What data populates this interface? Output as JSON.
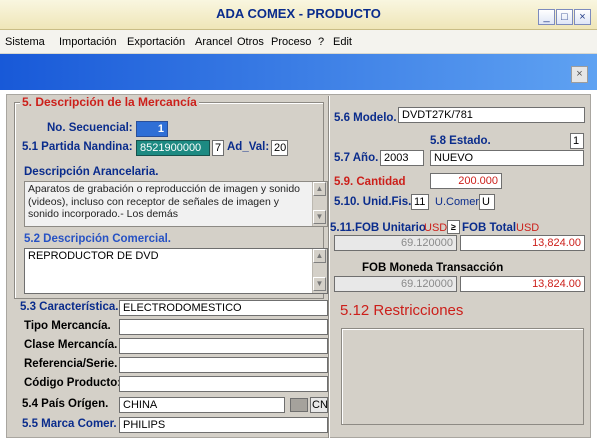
{
  "window": {
    "title": "ADA COMEX - PRODUCTO",
    "minimize_label": "_",
    "maximize_label": "□",
    "close_label": "×"
  },
  "menu": [
    "Sistema",
    "Importación",
    "Exportación",
    "Arancel",
    "Otros",
    "Proceso",
    "?",
    "Edit"
  ],
  "toolbar": {
    "close_label": "×"
  },
  "section5": {
    "title": "5. Descripción de la Mercancía",
    "no_secuencial_label": "No. Secuencial:",
    "no_secuencial_value": "1",
    "partida_label": "5.1 Partida Nandina:",
    "partida_value": "8521900000",
    "partida_digit": "7",
    "ad_val_label": "Ad_Val:",
    "ad_val_value": "20",
    "desc_arancelaria_label": "Descripción Arancelaria.",
    "desc_arancelaria_value": "Aparatos de grabación o reproducción de imagen y sonido (videos), incluso con receptor de señales de imagen y sonido incorporado.- Los demás",
    "desc_comercial_label": "5.2 Descripción Comercial.",
    "desc_comercial_value": "REPRODUCTOR DE DVD",
    "caracteristica_label": "5.3 Característica.",
    "caracteristica_value": "ELECTRODOMESTICO",
    "tipo_mercancia_label": "Tipo Mercancía.",
    "tipo_mercancia_value": "",
    "clase_mercancia_label": "Clase Mercancía.",
    "clase_mercancia_value": "",
    "referencia_label": "Referencia/Serie.",
    "referencia_value": "",
    "codigo_producto_label": "Código Producto:",
    "codigo_producto_value": "",
    "pais_origen_label": "5.4 País Orígen.",
    "pais_origen_value": "CHINA",
    "pais_origen_code": "CN",
    "marca_label": "5.5 Marca Comer.",
    "marca_value": "PHILIPS",
    "modelo_label": "5.6 Modelo.",
    "modelo_value": "DVDT27K/781",
    "estado_label": "5.8 Estado.",
    "estado_code": "1",
    "estado_value": "NUEVO",
    "anio_label": "5.7 Año.",
    "anio_value": "2003",
    "cantidad_label": "5.9. Cantidad",
    "cantidad_value": "200.000",
    "unid_fis_label": "5.10. Unid.Fis.",
    "unid_fis_value": "11",
    "u_comer_label": "U.Comer.",
    "u_comer_value": "U",
    "fob_unitario_label": "5.11.FOB Unitario",
    "fob_unitario_currency": "USD",
    "fob_unitario_value": "69.120000",
    "fob_arrow_label": "≥",
    "fob_total_label": "FOB Total",
    "fob_total_currency": "USD",
    "fob_total_value": "13,824.00",
    "fob_moneda_label": "FOB Moneda Transacción",
    "fob_moneda_unitario": "69.120000",
    "fob_moneda_total": "13,824.00"
  },
  "restricciones": {
    "title": "5.12 Restricciones"
  }
}
